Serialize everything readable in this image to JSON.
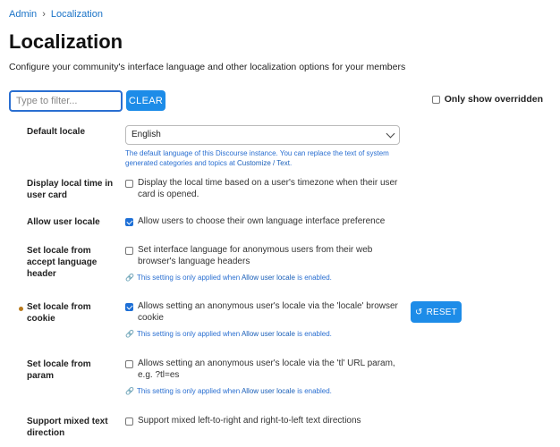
{
  "breadcrumb": {
    "admin": "Admin",
    "sep": "›",
    "current": "Localization"
  },
  "page": {
    "title": "Localization",
    "description": "Configure your community's interface language and other localization options for your members"
  },
  "filter": {
    "placeholder": "Type to filter...",
    "clear_label": "CLEAR",
    "override_label": "Only show overridden"
  },
  "settings": {
    "default_locale": {
      "label": "Default locale",
      "value": "English",
      "description": "The default language of this Discourse instance. You can replace the text of system generated categories and topics at ",
      "link": "Customize / Text",
      "tail": "."
    },
    "display_local_time": {
      "label": "Display local time in user card",
      "text": "Display the local time based on a user's timezone when their user card is opened.",
      "checked": false
    },
    "allow_user_locale": {
      "label": "Allow user locale",
      "text": "Allow users to choose their own language interface preference",
      "checked": true
    },
    "set_locale_accept": {
      "label": "Set locale from accept language header",
      "text": "Set interface language for anonymous users from their web browser's language headers",
      "checked": false,
      "hint_pre": "This setting is only applied when ",
      "hint_link": "Allow user locale",
      "hint_post": " is enabled."
    },
    "set_locale_cookie": {
      "label": "Set locale from cookie",
      "text": "Allows setting an anonymous user's locale via the 'locale' browser cookie",
      "checked": true,
      "hint_pre": "This setting is only applied when ",
      "hint_link": "Allow user locale",
      "hint_post": " is enabled.",
      "reset_label": "RESET"
    },
    "set_locale_param": {
      "label": "Set locale from param",
      "text": "Allows setting an anonymous user's locale via the 'tl' URL param, e.g. ?tl=es",
      "checked": false,
      "hint_pre": "This setting is only applied when ",
      "hint_link": "Allow user locale",
      "hint_post": " is enabled."
    },
    "mixed_text": {
      "label": "Support mixed text direction",
      "text": "Support mixed left-to-right and right-to-left text directions",
      "checked": false
    }
  },
  "colors": {
    "accent": "#1d8ce8",
    "link": "#2a6fd1",
    "changed_dot": "#b8791b"
  }
}
